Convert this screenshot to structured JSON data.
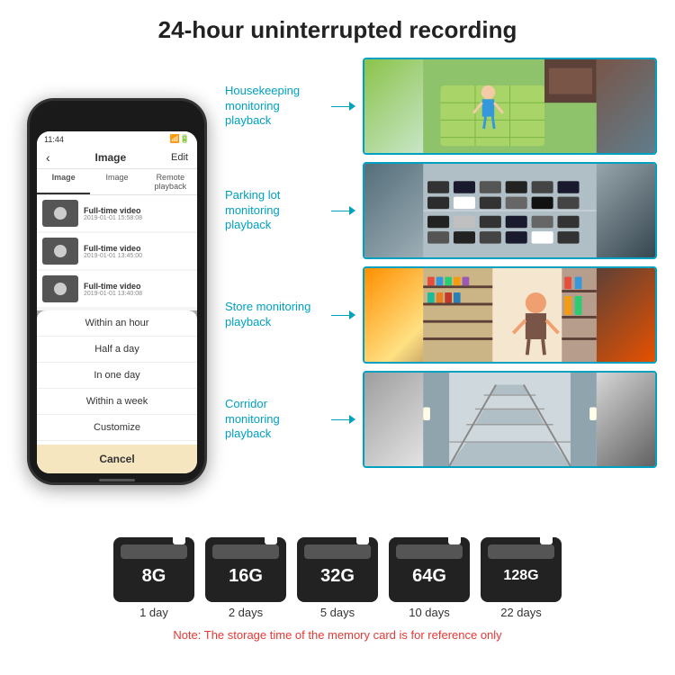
{
  "header": {
    "title": "24-hour uninterrupted recording"
  },
  "phone": {
    "time": "11:44",
    "screen_title": "Image",
    "edit_label": "Edit",
    "back_symbol": "‹",
    "tabs": [
      "Image",
      "Image",
      "Remote playback"
    ],
    "videos": [
      {
        "title": "Full-time video",
        "date": "2019-01-01 15:58:08"
      },
      {
        "title": "Full-time video",
        "date": "2019-01-01 13:45:00"
      },
      {
        "title": "Full-time video",
        "date": "2019-01-01 13:40:08"
      }
    ],
    "dropdown": {
      "items": [
        "Within an hour",
        "Half a day",
        "In one day",
        "Within a week",
        "Customize"
      ],
      "cancel": "Cancel"
    }
  },
  "monitoring": {
    "items": [
      {
        "label": "Housekeeping monitoring playback",
        "img_class": "img-housekeeping"
      },
      {
        "label": "Parking lot monitoring playback",
        "img_class": "img-parking"
      },
      {
        "label": "Store monitoring playback",
        "img_class": "img-store"
      },
      {
        "label": "Corridor monitoring playback",
        "img_class": "img-corridor"
      }
    ]
  },
  "sdcards": [
    {
      "size": "8G",
      "days": "1 day"
    },
    {
      "size": "16G",
      "days": "2 days"
    },
    {
      "size": "32G",
      "days": "5 days"
    },
    {
      "size": "64G",
      "days": "10 days"
    },
    {
      "size": "128G",
      "days": "22 days"
    }
  ],
  "note": "Note: The storage time of the memory card is for reference only"
}
